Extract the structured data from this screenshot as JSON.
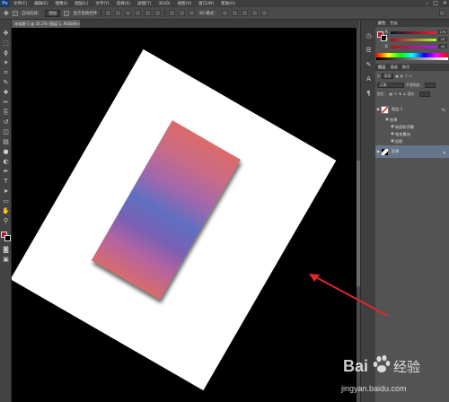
{
  "menubar": {
    "logo": "Ps",
    "items": [
      "文件(F)",
      "编辑(E)",
      "图像(I)",
      "图层(L)",
      "文字(Y)",
      "选择(S)",
      "滤镜(T)",
      "3D(D)",
      "视图(V)",
      "窗口(W)",
      "帮助(H)"
    ],
    "window_buttons": [
      "–",
      "□",
      "✕"
    ]
  },
  "options": {
    "auto_select_label": "自动选择：",
    "auto_select_value": "图层",
    "show_transform_label": "显示变换控件",
    "mode_3d_label": "3D 模式："
  },
  "document": {
    "tab_label": "未标题-1 @ 35.2% (图层 1, RGB/8)",
    "close": "×"
  },
  "tools": {
    "icons": [
      "move-icon",
      "marquee-icon",
      "lasso-icon",
      "magic-wand-icon",
      "crop-icon",
      "eyedropper-icon",
      "healing-brush-icon",
      "brush-icon",
      "clone-stamp-icon",
      "history-brush-icon",
      "eraser-icon",
      "gradient-icon",
      "blur-icon",
      "dodge-icon",
      "pen-icon",
      "type-icon",
      "path-select-icon",
      "shape-icon",
      "hand-icon",
      "zoom-icon"
    ],
    "glyphs": [
      "✥",
      "⬚",
      "ϕ",
      "✶",
      "⌗",
      "✎",
      "✚",
      "✏",
      "⎘",
      "↺",
      "◫",
      "▤",
      "●",
      "◐",
      "✒",
      "T",
      "➤",
      "▭",
      "✋",
      "⚲"
    ]
  },
  "color_panel": {
    "tabs": [
      "颜色",
      "色板"
    ],
    "channels": [
      {
        "label": "R",
        "value": "176"
      },
      {
        "label": "G",
        "value": "25"
      },
      {
        "label": "B",
        "value": "44"
      }
    ],
    "fg_color": "#b0192c",
    "bg_color": "#000000"
  },
  "layers_panel": {
    "tabs": [
      "图层",
      "通道",
      "路径"
    ],
    "kind_label": "类型",
    "blend_mode": "正常",
    "opacity_label": "不透明度：",
    "lock_label": "锁定：",
    "fill_label": "填充：",
    "layers": [
      {
        "name": "图层 1",
        "fx": "fx"
      },
      {
        "name": "效果",
        "fx": ""
      },
      {
        "name": "斜面和浮雕",
        "fx": ""
      },
      {
        "name": "渐变叠加",
        "fx": ""
      },
      {
        "name": "投影",
        "fx": ""
      },
      {
        "name": "背景",
        "fx": ""
      }
    ]
  },
  "watermark": {
    "text": "Bai 经验",
    "url": "jingyan.baidu.com"
  },
  "colors": {
    "accent_arrow": "#e0262b",
    "gradient_top": "#e46a6a",
    "gradient_mid": "#5f6fc8"
  }
}
